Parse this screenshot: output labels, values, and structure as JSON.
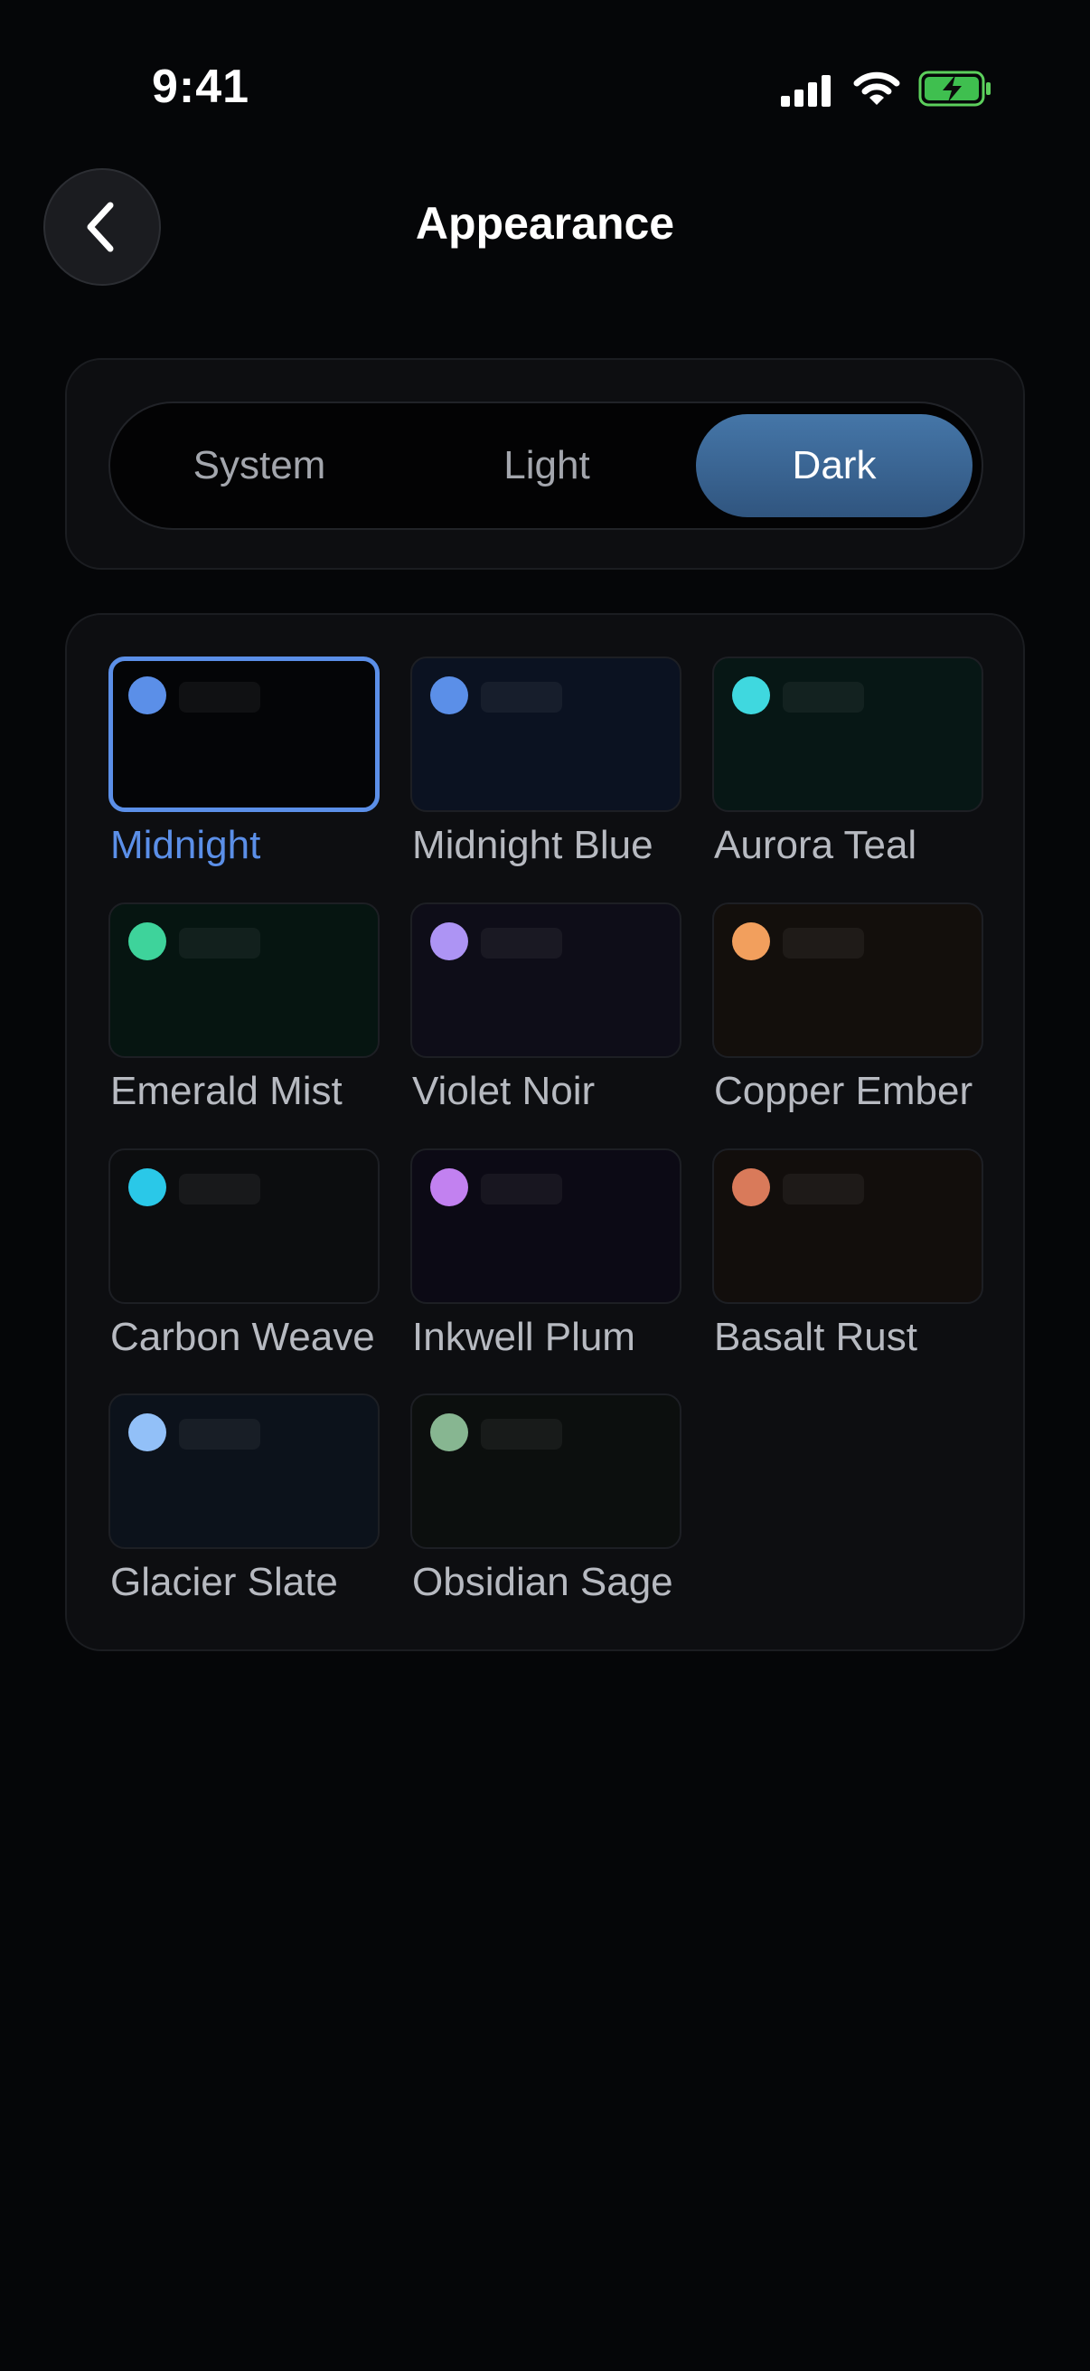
{
  "status_bar": {
    "time": "9:41"
  },
  "header": {
    "title": "Appearance"
  },
  "mode": {
    "options": [
      "System",
      "Light",
      "Dark"
    ],
    "selected": "Dark"
  },
  "themes": [
    {
      "name": "Midnight",
      "dot": "#5b8fe8",
      "bg": "#040507",
      "selected": true
    },
    {
      "name": "Midnight Blue",
      "dot": "#5b8fe8",
      "bg": "#0b1221"
    },
    {
      "name": "Aurora Teal",
      "dot": "#3fd8df",
      "bg": "#071715"
    },
    {
      "name": "Emerald Mist",
      "dot": "#3ed39b",
      "bg": "#061511"
    },
    {
      "name": "Violet Noir",
      "dot": "#ad94f4",
      "bg": "#0e0d18"
    },
    {
      "name": "Copper Ember",
      "dot": "#f29f5d",
      "bg": "#130f0c"
    },
    {
      "name": "Carbon Weave",
      "dot": "#2ac8e8",
      "bg": "#0c0d0f"
    },
    {
      "name": "Inkwell Plum",
      "dot": "#c281f0",
      "bg": "#0c0a15"
    },
    {
      "name": "Basalt Rust",
      "dot": "#d97a5a",
      "bg": "#120e0c"
    },
    {
      "name": "Glacier Slate",
      "dot": "#92c0f8",
      "bg": "#0c121b"
    },
    {
      "name": "Obsidian Sage",
      "dot": "#87b691",
      "bg": "#0c0f0e"
    }
  ]
}
